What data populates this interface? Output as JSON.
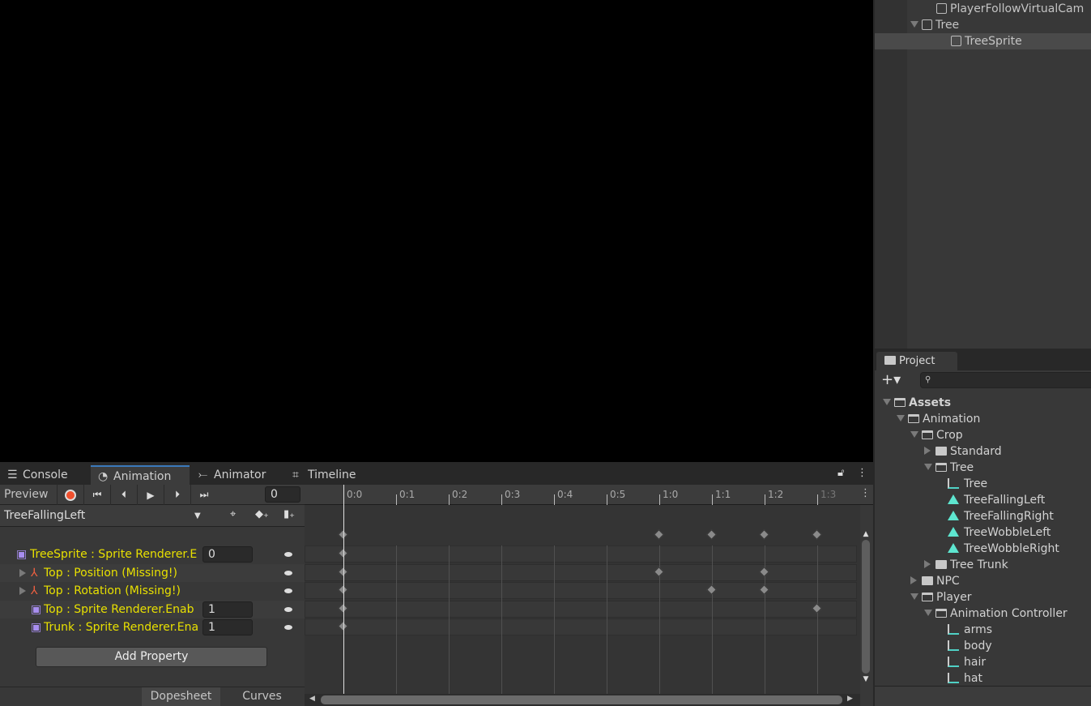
{
  "hierarchy": {
    "items": [
      {
        "label": "PlayerFollowVirtualCam",
        "indent": 2,
        "expanded": null
      },
      {
        "label": "Tree",
        "indent": 1,
        "expanded": true
      },
      {
        "label": "TreeSprite",
        "indent": 3,
        "expanded": null,
        "selected": true
      }
    ]
  },
  "project": {
    "tab": "Project",
    "add_label": "+▾",
    "search_placeholder": "",
    "items": [
      {
        "label": "Assets",
        "indent": 0,
        "type": "folder-open",
        "arrow": "down",
        "bold": true
      },
      {
        "label": "Animation",
        "indent": 1,
        "type": "folder-open",
        "arrow": "down"
      },
      {
        "label": "Crop",
        "indent": 2,
        "type": "folder-open",
        "arrow": "down"
      },
      {
        "label": "Standard",
        "indent": 3,
        "type": "folder",
        "arrow": "right"
      },
      {
        "label": "Tree",
        "indent": 3,
        "type": "folder-open",
        "arrow": "down"
      },
      {
        "label": "Tree",
        "indent": 4,
        "type": "controller"
      },
      {
        "label": "TreeFallingLeft",
        "indent": 4,
        "type": "clip"
      },
      {
        "label": "TreeFallingRight",
        "indent": 4,
        "type": "clip"
      },
      {
        "label": "TreeWobbleLeft",
        "indent": 4,
        "type": "clip"
      },
      {
        "label": "TreeWobbleRight",
        "indent": 4,
        "type": "clip"
      },
      {
        "label": "Tree Trunk",
        "indent": 3,
        "type": "folder",
        "arrow": "right"
      },
      {
        "label": "NPC",
        "indent": 2,
        "type": "folder",
        "arrow": "right"
      },
      {
        "label": "Player",
        "indent": 2,
        "type": "folder-open",
        "arrow": "down"
      },
      {
        "label": "Animation Controller",
        "indent": 3,
        "type": "folder-open",
        "arrow": "down"
      },
      {
        "label": "arms",
        "indent": 4,
        "type": "controller"
      },
      {
        "label": "body",
        "indent": 4,
        "type": "controller"
      },
      {
        "label": "hair",
        "indent": 4,
        "type": "controller"
      },
      {
        "label": "hat",
        "indent": 4,
        "type": "controller"
      }
    ]
  },
  "tabs": [
    {
      "label": "Console",
      "icon": "console-icon"
    },
    {
      "label": "Animation",
      "icon": "clock-icon",
      "active": true
    },
    {
      "label": "Animator",
      "icon": "animator-icon"
    },
    {
      "label": "Timeline",
      "icon": "film-icon"
    }
  ],
  "toolbar": {
    "preview": "Preview",
    "frame": "0",
    "record_color": "#f0502e"
  },
  "clip": {
    "selected": "TreeFallingLeft"
  },
  "properties": [
    {
      "label": "TreeSprite : Sprite Renderer.E",
      "value": "0",
      "foldout": false,
      "icon": "sprite-renderer-icon",
      "keys": [
        0
      ]
    },
    {
      "label": "Top : Position (Missing!)",
      "foldout": true,
      "icon": "transform-icon",
      "keys": [
        0,
        6,
        8
      ]
    },
    {
      "label": "Top : Rotation (Missing!)",
      "foldout": true,
      "icon": "transform-icon",
      "keys": [
        0,
        7,
        8
      ]
    },
    {
      "label": "Top : Sprite Renderer.Enab",
      "value": "1",
      "foldout": false,
      "icon": "sprite-renderer-icon",
      "keys": [
        0,
        9
      ]
    },
    {
      "label": "Trunk : Sprite Renderer.Ena",
      "value": "1",
      "foldout": false,
      "icon": "sprite-renderer-icon",
      "keys": [
        0
      ]
    }
  ],
  "summary_keys": [
    0,
    6,
    7,
    8,
    9
  ],
  "ruler": [
    "0:0",
    "0:1",
    "0:2",
    "0:3",
    "0:4",
    "0:5",
    "1:0",
    "1:1",
    "1:2",
    "1:3"
  ],
  "add_property": "Add Property",
  "modes": {
    "dopesheet": "Dopesheet",
    "curves": "Curves"
  },
  "text_color_missing": "#e8e000"
}
